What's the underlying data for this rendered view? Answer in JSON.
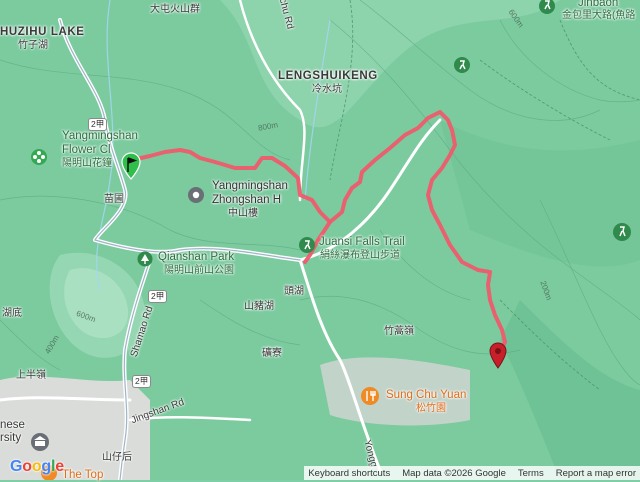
{
  "map": {
    "route_color": "#ef5b6b",
    "start_marker_color": "#2fbf4a",
    "end_marker_color": "#c8202a",
    "park_color": "#2c6e3f",
    "food_color": "#e06b17"
  },
  "labels": {
    "shuzihu_en": "HUZIHU LAKE",
    "shuzihu_zh": "竹子湖",
    "datun_zh": "大屯火山群",
    "lengshuikeng_en": "LENGSHUIKENG",
    "lengshuikeng_zh": "冷水坑",
    "jinbao_en": "Jinbaon",
    "jinbao_zh": "金包里大路(魚路",
    "flower_clock_en1": "Yangmingshan",
    "flower_clock_en2": "Flower Cl",
    "flower_clock_zh": "陽明山花鐘",
    "miaopu": "苗圃",
    "zhongshan_en1": "Yangmingshan",
    "zhongshan_en2": "Zhongshan H",
    "zhongshan_zh": "中山樓",
    "falls_en": "Juansi Falls Trail",
    "falls_zh": "絹絲瀑布登山步道",
    "qianshan_en": "Qianshan Park",
    "qianshan_zh": "陽明山前山公園",
    "toutu": "頭湖",
    "shanzhu": "山豬湖",
    "zhuhao": "竹蒿嶺",
    "hudi": "湖底",
    "shangban": "上半嶺",
    "kuangliao": "礦寮",
    "shanzaihou": "山仔后",
    "sungchu_en": "Sung Chu Yuan",
    "sungchu_zh": "松竹園",
    "shamao_rd": "Shamao Rd",
    "jingshan_rd": "Jingshan Rd",
    "yongg": "Yongg",
    "nese": "nese",
    "rsity": "rsity",
    "the_top": "The Top",
    "chu_rd": "chu Rd",
    "contour_800": "800m",
    "contour_600a": "600m",
    "contour_600b": "600m",
    "contour_400": "400m",
    "contour_200": "200m",
    "shield_2a": "2甲",
    "shield_2b": "2甲",
    "shield_2c": "2甲"
  },
  "footer": {
    "google": "Google",
    "shortcuts": "Keyboard shortcuts",
    "map_data": "Map data ©2026 Google",
    "terms": "Terms",
    "report": "Report a map error"
  }
}
